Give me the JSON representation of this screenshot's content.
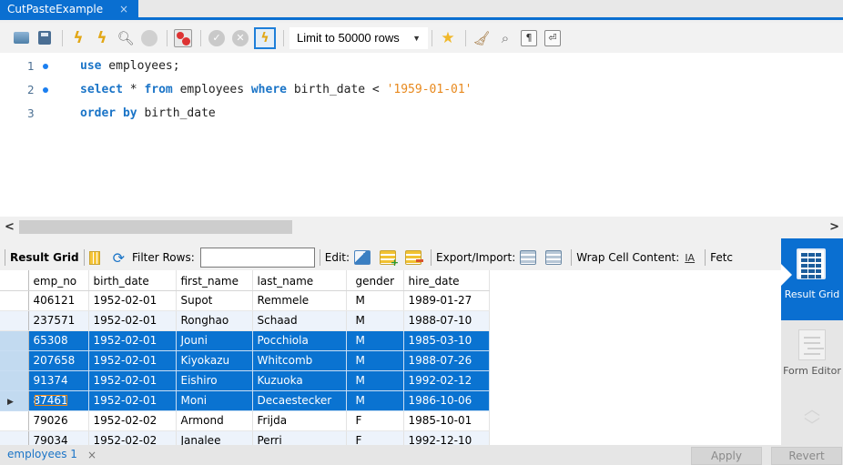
{
  "window": {
    "tab_title": "CutPasteExample",
    "tab_close": "×"
  },
  "toolbar": {
    "limit_select_value": "Limit to 50000 rows",
    "icons": [
      "open-folder-icon",
      "save-icon",
      "execute-icon",
      "execute-current-icon",
      "explain-icon",
      "stop-icon",
      "toggle-error-icon",
      "commit-icon",
      "rollback-icon",
      "autocommit-icon",
      "beautify-favorite-icon",
      "beautify-icon",
      "find-icon",
      "invisible-chars-icon",
      "wrap-icon"
    ]
  },
  "editor": {
    "lines": [
      {
        "num": "1",
        "has_bullet": true,
        "tokens": [
          {
            "t": "use",
            "k": "kw"
          },
          {
            "t": " employees;",
            "k": ""
          }
        ]
      },
      {
        "num": "2",
        "has_bullet": true,
        "tokens": [
          {
            "t": "select",
            "k": "kw"
          },
          {
            "t": " * ",
            "k": ""
          },
          {
            "t": "from",
            "k": "kw"
          },
          {
            "t": " employees ",
            "k": ""
          },
          {
            "t": "where",
            "k": "kw"
          },
          {
            "t": " birth_date < ",
            "k": ""
          },
          {
            "t": "'1959-01-01'",
            "k": "str"
          }
        ]
      },
      {
        "num": "3",
        "has_bullet": false,
        "tokens": [
          {
            "t": "order by",
            "k": "kw"
          },
          {
            "t": " birth_date",
            "k": ""
          }
        ]
      }
    ]
  },
  "scrollbar": {
    "left_arrow": "<",
    "right_arrow": ">"
  },
  "result_toolbar": {
    "result_grid_label": "Result Grid",
    "filter_rows_label": "Filter Rows:",
    "filter_rows_value": "",
    "edit_label": "Edit:",
    "export_import_label": "Export/Import:",
    "wrap_label": "Wrap Cell Content:",
    "wrap_icon_text": "IA",
    "fetch_label": "Fetc"
  },
  "side_panel": {
    "result_grid": "Result Grid",
    "form_editor": "Form Editor"
  },
  "grid": {
    "columns": [
      "emp_no",
      "birth_date",
      "first_name",
      "last_name",
      "gender",
      "hire_date"
    ],
    "rows": [
      {
        "cells": [
          "406121",
          "1952-02-01",
          "Supot",
          "Remmele",
          "M",
          "1989-01-27"
        ],
        "selected": false,
        "current": false
      },
      {
        "cells": [
          "237571",
          "1952-02-01",
          "Ronghao",
          "Schaad",
          "M",
          "1988-07-10"
        ],
        "selected": false,
        "current": false
      },
      {
        "cells": [
          "65308",
          "1952-02-01",
          "Jouni",
          "Pocchiola",
          "M",
          "1985-03-10"
        ],
        "selected": true,
        "current": false
      },
      {
        "cells": [
          "207658",
          "1952-02-01",
          "Kiyokazu",
          "Whitcomb",
          "M",
          "1988-07-26"
        ],
        "selected": true,
        "current": false
      },
      {
        "cells": [
          "91374",
          "1952-02-01",
          "Eishiro",
          "Kuzuoka",
          "M",
          "1992-02-12"
        ],
        "selected": true,
        "current": false
      },
      {
        "cells": [
          "87461",
          "1952-02-01",
          "Moni",
          "Decaestecker",
          "M",
          "1986-10-06"
        ],
        "selected": true,
        "current": true
      },
      {
        "cells": [
          "79026",
          "1952-02-02",
          "Armond",
          "Frijda",
          "F",
          "1985-10-01"
        ],
        "selected": false,
        "current": false
      },
      {
        "cells": [
          "79034",
          "1952-02-02",
          "Janalee",
          "Perri",
          "F",
          "1992-12-10"
        ],
        "selected": false,
        "current": false
      }
    ]
  },
  "bottom": {
    "tab_label": "employees 1",
    "tab_close": "×",
    "apply_label": "Apply",
    "revert_label": "Revert"
  },
  "colors": {
    "accent": "#0a6fd1",
    "selection": "#0a73d1",
    "keyword": "#1a74c7",
    "string": "#e8891d"
  }
}
